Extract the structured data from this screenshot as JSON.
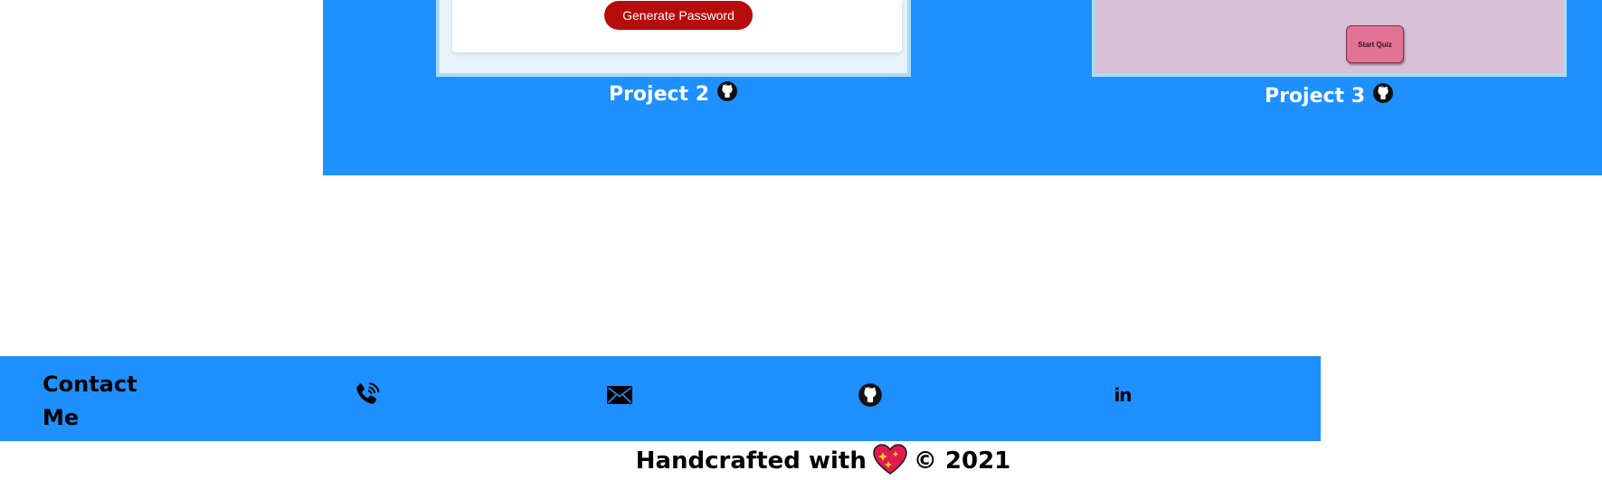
{
  "projects": {
    "items": [
      {
        "caption": "Project 2",
        "preview_button": "Generate Password"
      },
      {
        "caption": "Project 3",
        "preview_button": "Start Quiz"
      }
    ]
  },
  "contact": {
    "title": "Contact Me",
    "icons": [
      "phone-icon",
      "email-icon",
      "github-icon",
      "linkedin-icon"
    ],
    "linkedin_glyph": "in"
  },
  "footer": {
    "prefix": "Handcrafted with",
    "suffix": "© 2021"
  },
  "colors": {
    "accent": "#1e90ff",
    "generate_button": "#b70c0c",
    "quiz_button": "#e07394",
    "quiz_background": "#d8bfd8"
  }
}
